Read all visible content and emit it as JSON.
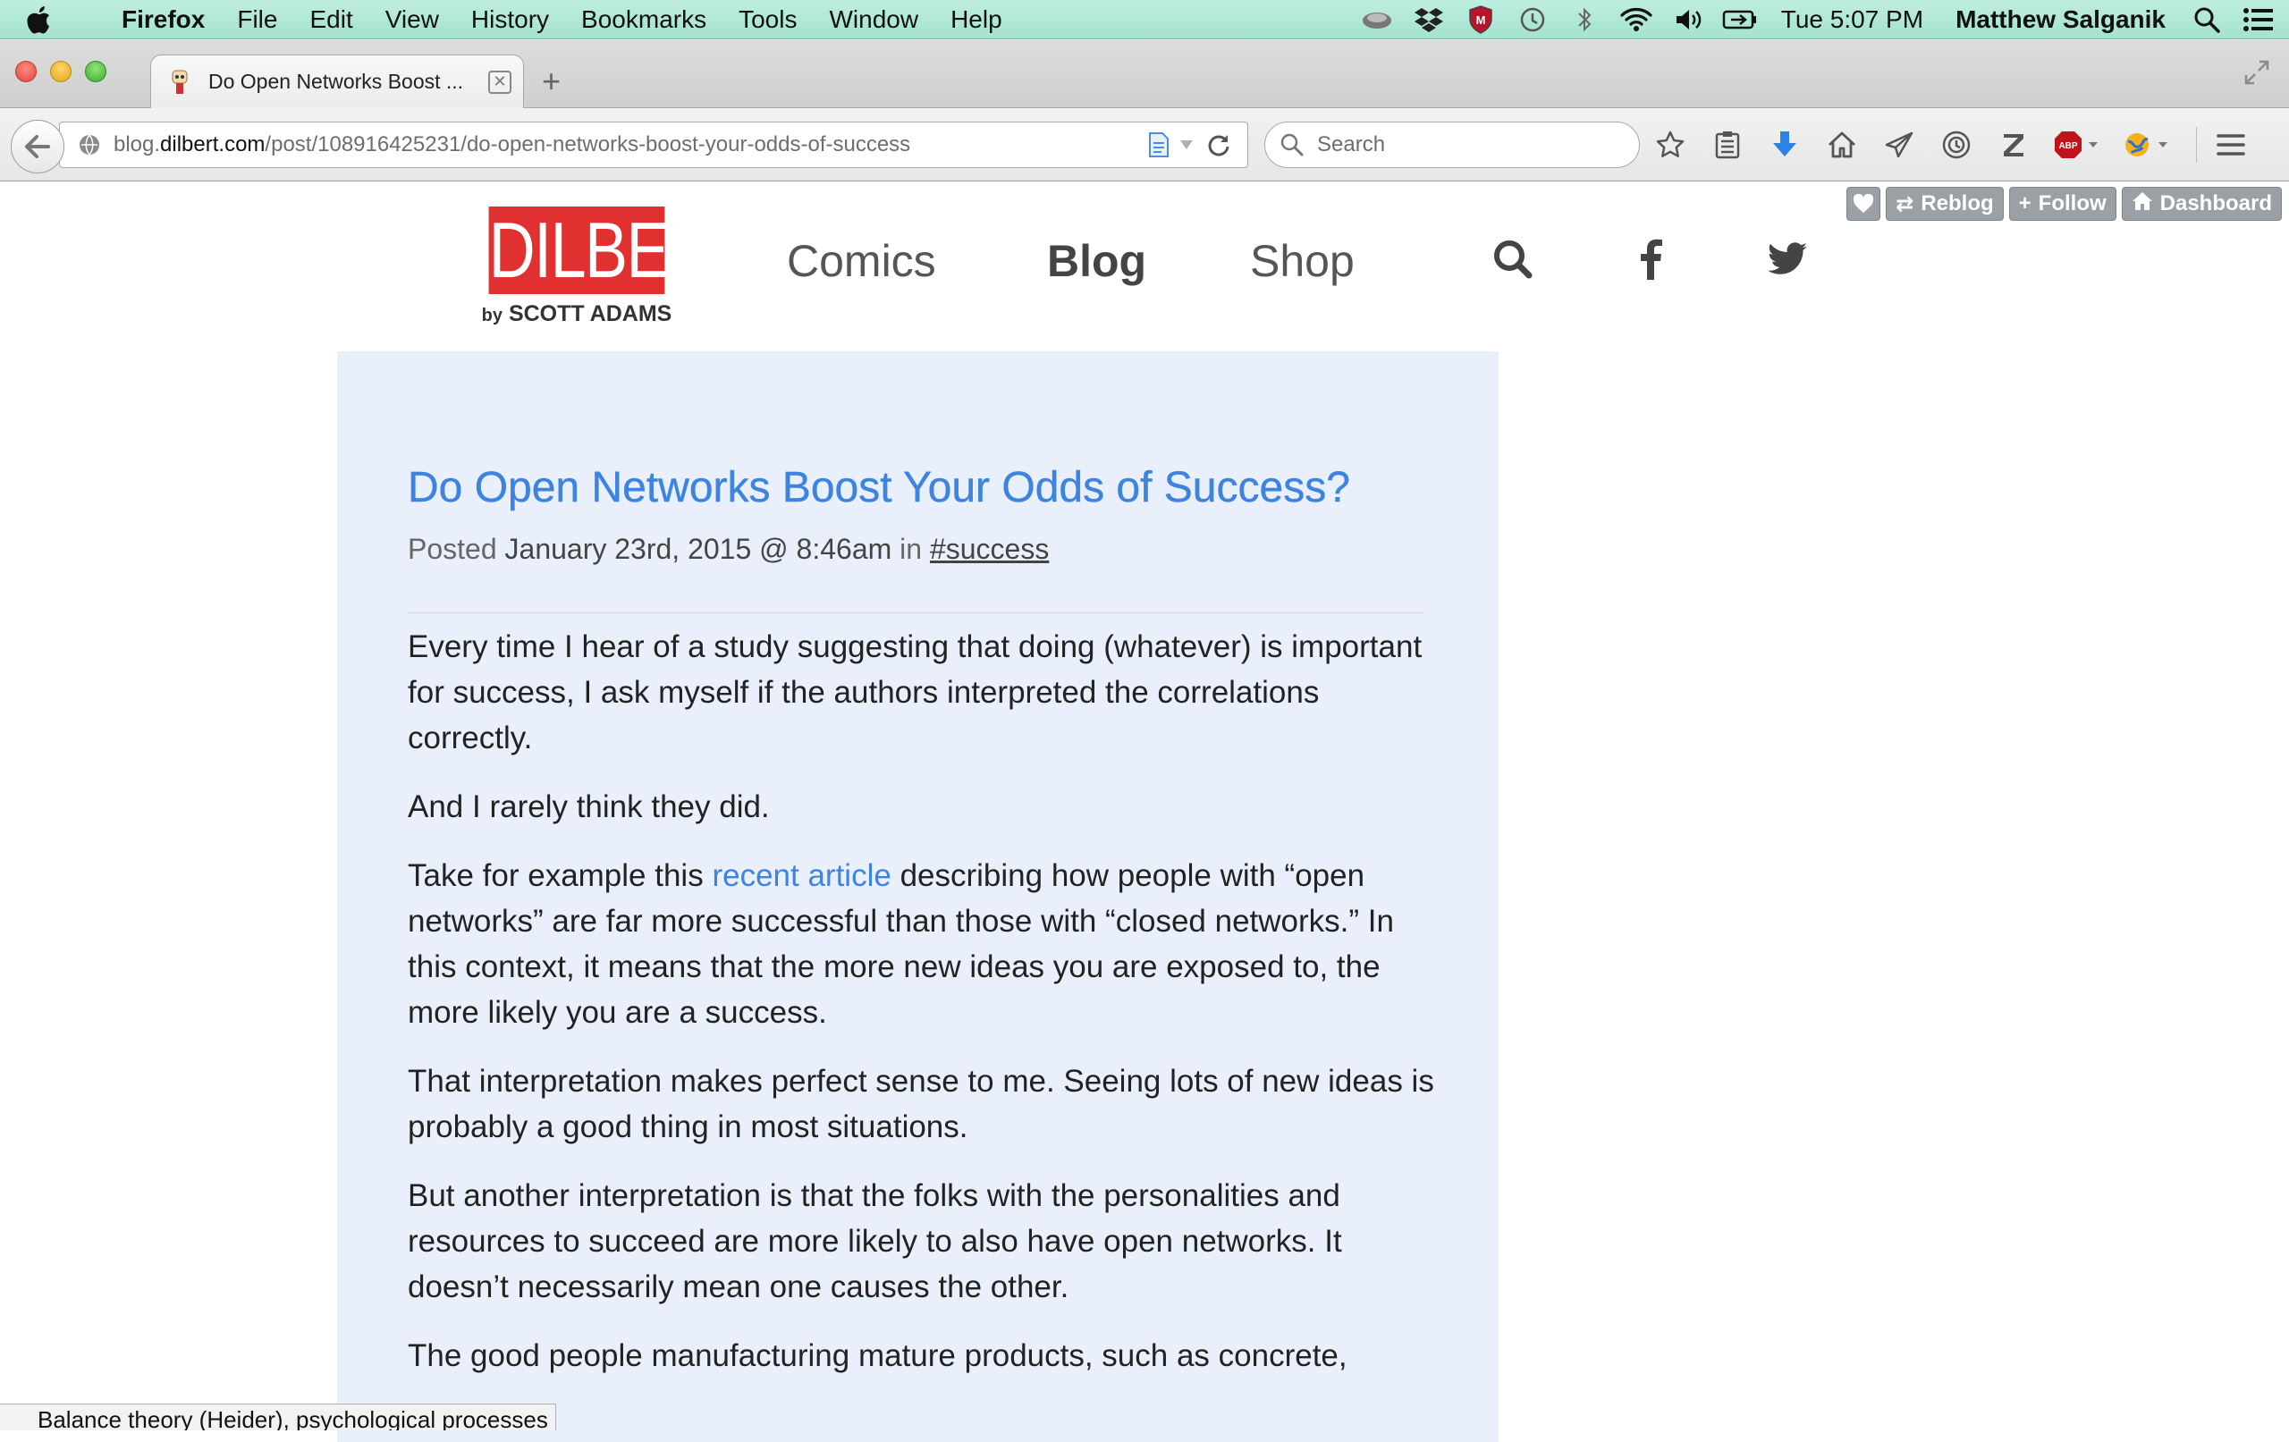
{
  "menubar": {
    "app": "Firefox",
    "items": [
      "File",
      "Edit",
      "View",
      "History",
      "Bookmarks",
      "Tools",
      "Window",
      "Help"
    ],
    "clock": "Tue 5:07 PM",
    "user": "Matthew Salganik",
    "status_icons": [
      "growl-icon",
      "dropbox-icon",
      "mcafee-icon",
      "time-machine-icon",
      "bluetooth-icon",
      "wifi-icon",
      "volume-icon",
      "battery-icon"
    ]
  },
  "browser": {
    "tab_title": "Do Open Networks Boost ...",
    "url_prefix": "blog.",
    "url_domain": "dilbert.com",
    "url_path": "/post/108916425231/do-open-networks-boost-your-odds-of-success",
    "search_placeholder": "Search",
    "toolbar_icons": [
      "bookmark-star-icon",
      "reading-list-icon",
      "downloads-icon",
      "home-icon",
      "send-icon",
      "history-icon",
      "zotero-icon",
      "adblock-plus-icon",
      "globe-addon-icon",
      "menu-icon"
    ]
  },
  "tumblr": {
    "reblog": "Reblog",
    "follow": "Follow",
    "dashboard": "Dashboard"
  },
  "site": {
    "logo": "DILBERT",
    "byline_by": "by",
    "byline_name": "SCOTT ADAMS",
    "nav": [
      "Comics",
      "Blog",
      "Shop"
    ],
    "active_nav": "Blog"
  },
  "post": {
    "title": "Do Open Networks Boost Your Odds of Success?",
    "posted_label": "Posted",
    "date": "January 23rd, 2015 @ 8:46am",
    "in_label": "in",
    "tag": "#success",
    "paragraphs": [
      "Every time I hear of a study suggesting that doing (whatever) is important for success, I ask myself if the authors interpreted the correlations correctly.",
      "And I rarely think they did.",
      "That interpretation makes perfect sense to me. Seeing lots of new ideas is probably a good thing in most situations.",
      "But another interpretation is that the folks with the personalities and resources to succeed are more likely to also have open networks. It doesn’t necessarily mean one causes the other.",
      "The good people manufacturing mature products, such as concrete,"
    ],
    "p3_before": "Take for example this",
    "p3_link": "recent article",
    "p3_after": "describing how people with “open networks” are far more successful than those with “closed networks.” In this context, it means that the more new ideas you are exposed to, the more likely you are a success."
  },
  "status_tooltip": "Balance theory (Heider), psychological processes"
}
